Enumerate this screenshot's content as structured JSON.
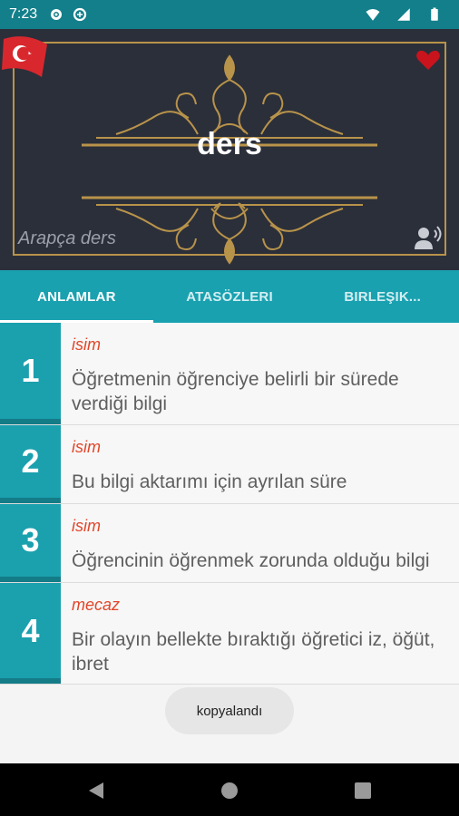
{
  "status_bar": {
    "time": "7:23"
  },
  "header": {
    "word": "ders",
    "subtitle": "Arapça ders",
    "colors": {
      "background": "#2b2f3a",
      "gold": "#b8934a",
      "heart": "#c9141d"
    }
  },
  "tabs": [
    {
      "label": "ANLAMLAR",
      "active": true
    },
    {
      "label": "ATASÖZLERI",
      "active": false
    },
    {
      "label": "BIRLEŞIK...",
      "active": false
    }
  ],
  "meanings": [
    {
      "number": "1",
      "type": "isim",
      "text": "Öğretmenin öğrenciye belirli bir sürede verdiği bilgi"
    },
    {
      "number": "2",
      "type": "isim",
      "text": "Bu bilgi aktarımı için ayrılan süre"
    },
    {
      "number": "3",
      "type": "isim",
      "text": "Öğrencinin öğrenmek zorunda olduğu bilgi"
    },
    {
      "number": "4",
      "type": "mecaz",
      "text": "Bir olayın bellekte bıraktığı öğretici iz, öğüt, ibret"
    }
  ],
  "toast": {
    "text": "kopyalandı"
  }
}
